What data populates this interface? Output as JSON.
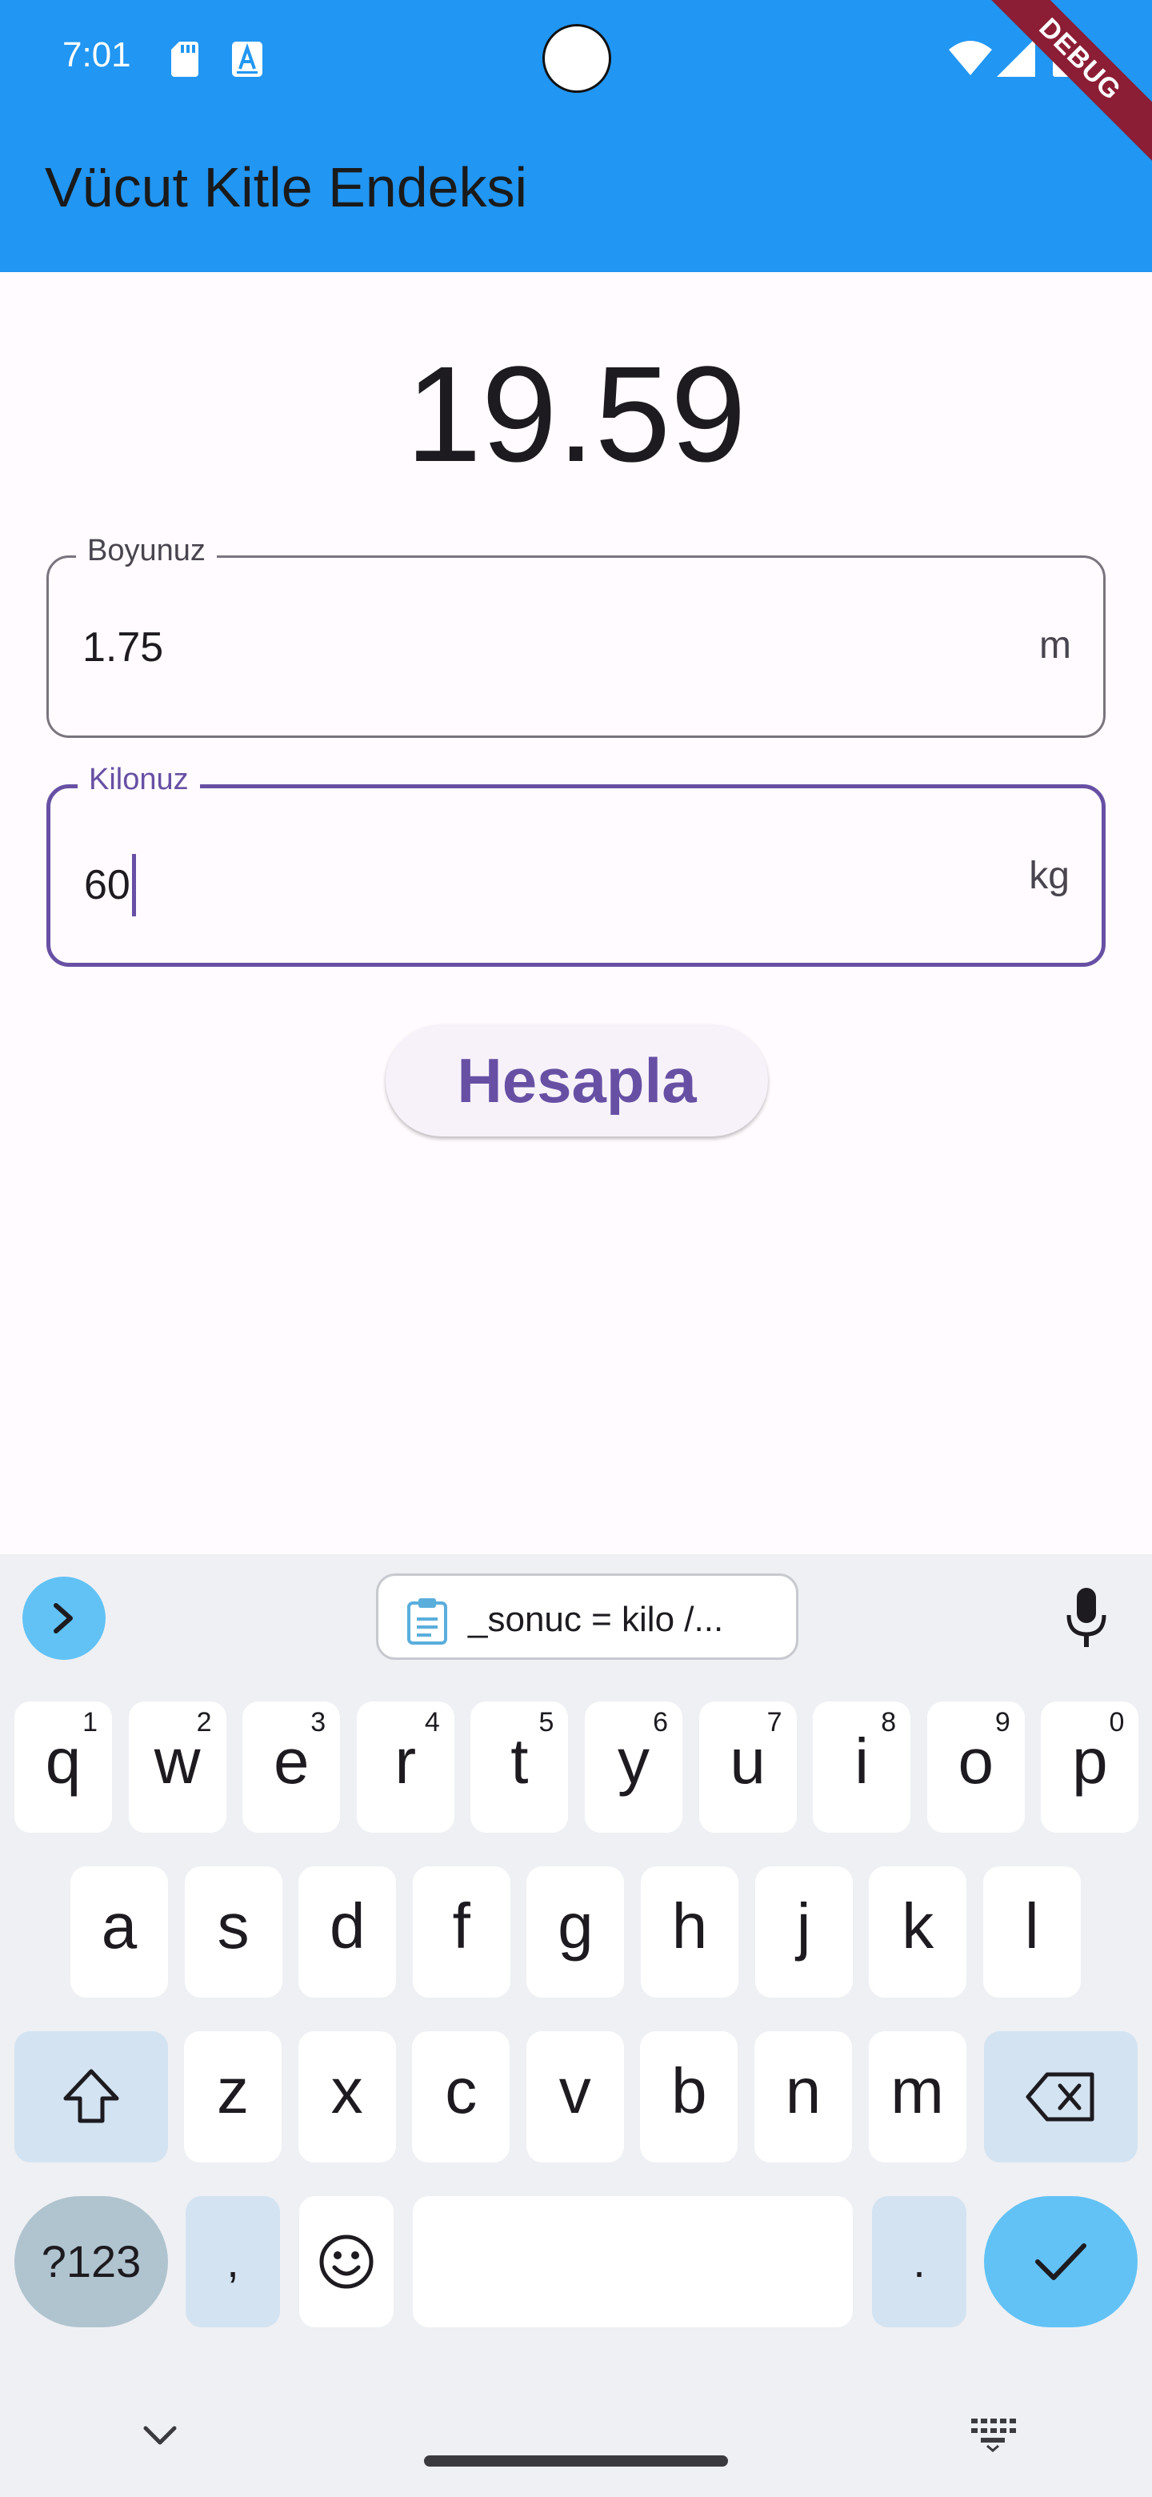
{
  "status_bar": {
    "time": "7:01",
    "debug_label": "DEBUG"
  },
  "app_bar": {
    "title": "Vücut Kitle Endeksi",
    "color": "#2196f3"
  },
  "main": {
    "result": "19.59",
    "height_field": {
      "label": "Boyunuz",
      "value": "1.75",
      "suffix": "m"
    },
    "weight_field": {
      "label": "Kilonuz",
      "value": "60",
      "suffix": "kg"
    },
    "calculate_button": "Hesapla"
  },
  "keyboard": {
    "clipboard_suggestion": "_sonuc = kilo /...",
    "row1": [
      {
        "key": "q",
        "hint": "1"
      },
      {
        "key": "w",
        "hint": "2"
      },
      {
        "key": "e",
        "hint": "3"
      },
      {
        "key": "r",
        "hint": "4"
      },
      {
        "key": "t",
        "hint": "5"
      },
      {
        "key": "y",
        "hint": "6"
      },
      {
        "key": "u",
        "hint": "7"
      },
      {
        "key": "i",
        "hint": "8"
      },
      {
        "key": "o",
        "hint": "9"
      },
      {
        "key": "p",
        "hint": "0"
      }
    ],
    "row2": [
      "a",
      "s",
      "d",
      "f",
      "g",
      "h",
      "j",
      "k",
      "l"
    ],
    "row3": [
      "z",
      "x",
      "c",
      "v",
      "b",
      "n",
      "m"
    ],
    "symbols_key": "?123",
    "comma_key": ",",
    "period_key": "."
  },
  "icons": {
    "sd": "sd-card-icon",
    "a": "text-a-icon",
    "wifi": "wifi-icon",
    "signal": "signal-icon",
    "battery": "battery-icon",
    "expand": "chevron-right-icon",
    "clipboard": "clipboard-icon",
    "mic": "mic-icon",
    "shift": "shift-icon",
    "backspace": "backspace-icon",
    "emoji": "emoji-icon",
    "enter": "check-icon",
    "nav_down": "chevron-down-icon",
    "keyboard": "keyboard-icon"
  }
}
